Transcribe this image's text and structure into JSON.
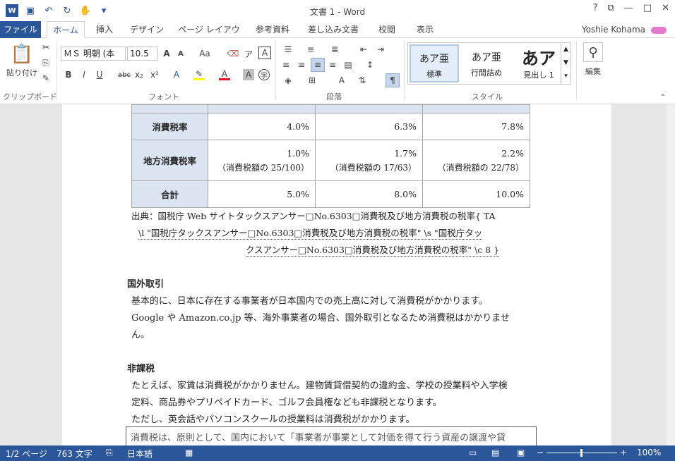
{
  "window": {
    "title": "文書 1 - Word",
    "help": "?",
    "restore": "⧉",
    "minimize": "—",
    "maximize": "□",
    "close": "✕"
  },
  "tabs": [
    "ファイル",
    "ホーム",
    "挿入",
    "デザイン",
    "ページ レイアウト",
    "参考資料",
    "差し込み文書",
    "校閲",
    "表示"
  ],
  "user": "Yoshie Kohama",
  "ribbon": {
    "clipboard": {
      "paste": "貼り付け",
      "label": "クリップボード"
    },
    "font": {
      "name": "ＭＳ 明朝 (本",
      "size": "10.5",
      "label": "フォント"
    },
    "paragraph": {
      "label": "段落"
    },
    "styles": {
      "items": [
        {
          "sample": "あア亜",
          "name": "標準"
        },
        {
          "sample": "あア亜",
          "name": "行間詰め"
        },
        {
          "sample": "あア",
          "name": "見出し 1"
        }
      ],
      "label": "スタイル"
    },
    "edit": {
      "label": "編集"
    }
  },
  "table": {
    "rows": [
      {
        "head": "消費税率",
        "values": [
          "4.0%",
          "6.3%",
          "7.8%"
        ],
        "notes": [
          "",
          "",
          ""
        ]
      },
      {
        "head": "地方消費税率",
        "values": [
          "1.0%",
          "1.7%",
          "2.2%"
        ],
        "notes": [
          "（消費税額の 25/100）",
          "（消費税額の 17/63）",
          "（消費税額の 22/78）"
        ]
      },
      {
        "head": "合計",
        "values": [
          "5.0%",
          "8.0%",
          "10.0%"
        ],
        "notes": [
          "",
          "",
          ""
        ]
      }
    ]
  },
  "doc": {
    "source1": "出典：国税庁 Web サイトタックスアンサー□No.6303□消費税及び地方消費税の税率{ TA",
    "source2": "\\l \"国税庁タックスアンサー□No.6303□消費税及び地方消費税の税率\" \\s \"国税庁タッ",
    "source3": "クスアンサー□No.6303□消費税及び地方消費税の税率\" \\c 8 }",
    "h1": "国外取引",
    "p1a": "基本的に、日本に存在する事業者が日本国内での売上高に対して消費税がかかります。",
    "p1b": "Google や Amazon.co.jp 等、海外事業者の場合、国外取引となるため消費税はかかりませ",
    "p1c": "ん。",
    "h2": "非課税",
    "p2a": "たとえば、家賃は消費税がかかりません。建物賃貸借契約の違約金、学校の授業料や入学検",
    "p2b": "定料、商品券やプリペイドカード、ゴルフ会員権なども非課税となります。",
    "p2c": "ただし、英会話やパソコンスクールの授業料は消費税がかかります。",
    "box": "消費税は、原則として、国内において「事業者が事業として対価を得て行う資産の譲渡や貸"
  },
  "status": {
    "page": "1/2 ページ",
    "words": "763 文字",
    "lang": "日本語",
    "zoom": "100%"
  }
}
